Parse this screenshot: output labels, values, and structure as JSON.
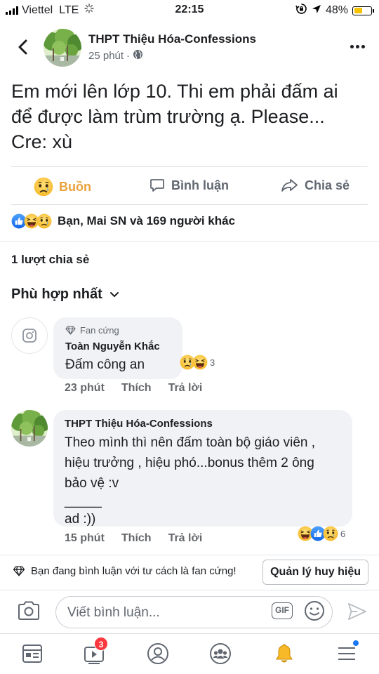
{
  "status": {
    "carrier": "Viettel",
    "network": "LTE",
    "time": "22:15",
    "battery_text": "48%",
    "battery_level": 0.48
  },
  "post": {
    "page_name": "THPT Thiệu Hóa-Confessions",
    "time": "25 phút",
    "dot": "·",
    "text_lines": [
      "Em mới lên lớp 10. Thi em phải đấm ai",
      "để được làm trùm trường ạ. Please...",
      "Cre: xù"
    ]
  },
  "actions": {
    "react_label": "Buồn",
    "comment_label": "Bình luận",
    "share_label": "Chia sẻ"
  },
  "reactions_summary": "Bạn, Mai SN và 169 người khác",
  "shares": "1 lượt chia sẻ",
  "sort_label": "Phù hợp nhất",
  "comments": [
    {
      "badge": "Fan cứng",
      "author": "Toàn Nguyễn Khắc",
      "text": "Đấm công an",
      "time": "23 phút",
      "like": "Thích",
      "reply": "Trả lời",
      "react_count": "3"
    },
    {
      "author": "THPT Thiệu Hóa-Confessions",
      "text_lines": [
        "Theo mình thì nên đấm toàn bộ giáo viên ,",
        "hiệu trưởng , hiệu phó...bonus thêm 2 ông",
        "bảo vệ :v",
        "_____",
        "ad :))"
      ],
      "time": "15 phút",
      "like": "Thích",
      "reply": "Trả lời",
      "react_count": "6"
    }
  ],
  "fan_bar": {
    "text": "Bạn đang bình luận với tư cách là fan cứng!",
    "button": "Quản lý huy hiệu"
  },
  "composer": {
    "placeholder": "Viết bình luận...",
    "gif": "GIF"
  },
  "tabbar": {
    "video_badge": "3"
  },
  "colors": {
    "accent": "#1877f2",
    "sad": "#e9a23b",
    "badge_red": "#fa383e"
  }
}
